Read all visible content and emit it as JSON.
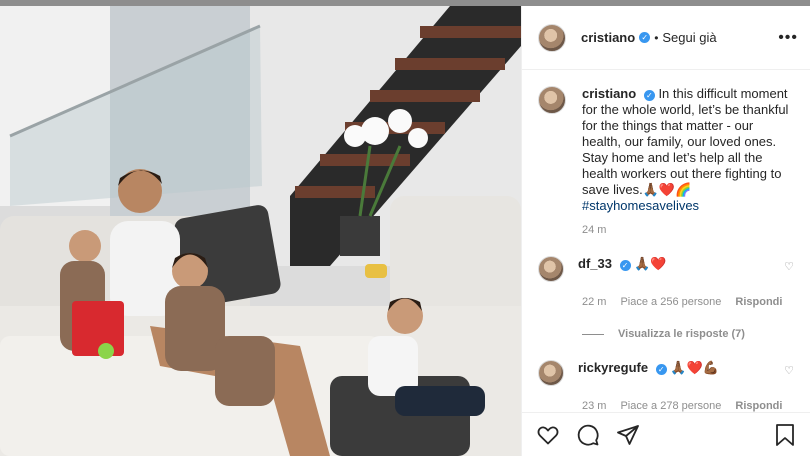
{
  "header": {
    "username": "cristiano",
    "follow_text": "Segui già",
    "more": "•••"
  },
  "post": {
    "username": "cristiano",
    "caption": "In this difficult moment for the whole world, let’s be thankful for the things that matter - our health, our family, our loved ones. Stay home and let’s help all the health workers out there fighting to save lives.🙏🏾❤️🌈",
    "hashtag": "#stayhomesavelives",
    "time": "24 m"
  },
  "comments": [
    {
      "username": "df_33",
      "text": "🙏🏾❤️",
      "time": "22 m",
      "likes": "Piace a 256 persone",
      "reply": "Rispondi",
      "view_replies": "Visualizza le risposte (7)"
    },
    {
      "username": "rickyregufe",
      "text": "🙏🏾❤️💪🏾",
      "time": "23 m",
      "likes": "Piace a 278 persone",
      "reply": "Rispondi"
    }
  ],
  "colors": {
    "verified": "#3897f0",
    "hashtag": "#00376b",
    "muted": "#8e8e8e",
    "border": "#efefef"
  },
  "icons": {
    "like": "heart-icon",
    "comment": "comment-icon",
    "share": "share-icon",
    "save": "bookmark-icon",
    "verified": "verified-badge-icon"
  }
}
